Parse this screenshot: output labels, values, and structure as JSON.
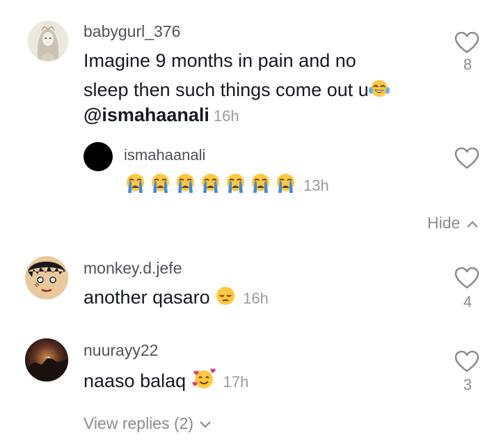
{
  "comments": [
    {
      "username": "babygurl_376",
      "text_line1": "Imagine 9 months in pain and no",
      "text_line2": "sleep then such things come out u",
      "mention": "@ismahaanali",
      "time": "16h",
      "likes": "8",
      "emoji": "joy-tears",
      "reply": {
        "username": "ismahaanali",
        "emoji": "loudly-crying",
        "emoji_count": 7,
        "time": "13h"
      },
      "hide_label": "Hide"
    },
    {
      "username": "monkey.d.jefe",
      "text": "another qasaro",
      "emoji": "pensive",
      "time": "16h",
      "likes": "4"
    },
    {
      "username": "nuurayy22",
      "text": "naaso balaq",
      "emoji": "smiling-face-with-hearts",
      "time": "17h",
      "likes": "3",
      "view_replies_label": "View replies (2)"
    }
  ],
  "colors": {
    "text": "#161823",
    "secondary": "#8a8b91",
    "background": "#ffffff"
  }
}
